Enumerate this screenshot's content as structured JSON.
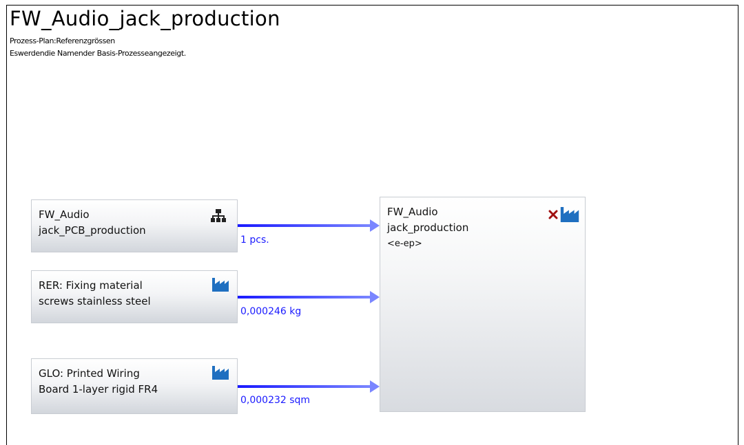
{
  "title": "FW_Audio_jack_production",
  "subtitle_plan": "Prozess-Plan:Referenzgrössen",
  "subtitle_note": "Eswerdendie Namender Basis-Prozesseangezeigt.",
  "inputs": [
    {
      "line1": "FW_Audio",
      "line2": "jack_PCB_production",
      "icon": "hierarchy-icon",
      "quantity": "1 pcs."
    },
    {
      "line1": "RER: Fixing material",
      "line2": "screws stainless steel",
      "icon": "factory-icon",
      "quantity": "0,000246 kg"
    },
    {
      "line1": "GLO: Printed Wiring",
      "line2": "Board 1-layer rigid FR4",
      "icon": "factory-icon",
      "quantity": "0,000232 sqm"
    }
  ],
  "output": {
    "line1": "FW_Audio",
    "line2": "jack_production",
    "line3": "<e-ep>",
    "icons": [
      "remove-x-icon",
      "factory-icon"
    ]
  },
  "colors": {
    "flow_arrow": "#1a1aff",
    "quantity_text": "#1a1aff",
    "factory_icon": "#1f6fc0",
    "x_icon": "#a01010"
  }
}
